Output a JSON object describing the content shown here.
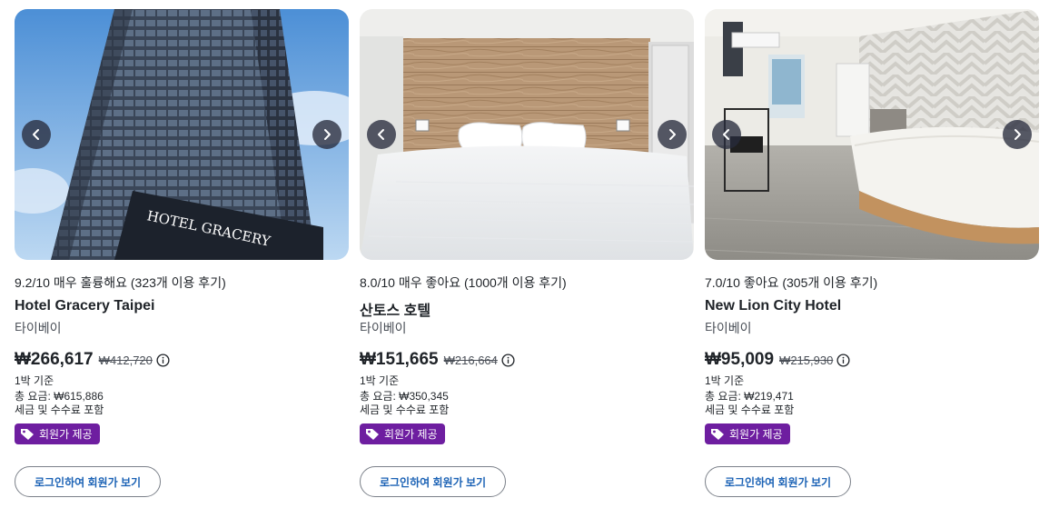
{
  "colors": {
    "member_badge_bg": "#6e1ea0",
    "login_button_text": "#1b62b5",
    "arrow_bg": "#2c3040"
  },
  "icons": {
    "prev": "chevron-left-icon",
    "next": "chevron-right-icon",
    "info": "info-circle-icon",
    "tag": "tag-icon"
  },
  "hotels": [
    {
      "rating": "9.2/10 매우 훌륭해요 (323개 이용 후기)",
      "name": "Hotel Gracery Taipei",
      "city": "타이베이",
      "price": "₩266,617",
      "old_price": "₩412,720",
      "per_night": "1박 기준",
      "total": "총 요금: ₩615,886",
      "taxes": "세금 및 수수료 포함",
      "badge": "회원가 제공",
      "login_button": "로그인하여 회원가 보기",
      "image_sign": "HOTEL GRACERY"
    },
    {
      "rating": "8.0/10 매우 좋아요 (1000개 이용 후기)",
      "name": "산토스 호텔",
      "city": "타이베이",
      "price": "₩151,665",
      "old_price": "₩216,664",
      "per_night": "1박 기준",
      "total": "총 요금: ₩350,345",
      "taxes": "세금 및 수수료 포함",
      "badge": "회원가 제공",
      "login_button": "로그인하여 회원가 보기"
    },
    {
      "rating": "7.0/10 좋아요 (305개 이용 후기)",
      "name": "New Lion City Hotel",
      "city": "타이베이",
      "price": "₩95,009",
      "old_price": "₩215,930",
      "per_night": "1박 기준",
      "total": "총 요금: ₩219,471",
      "taxes": "세금 및 수수료 포함",
      "badge": "회원가 제공",
      "login_button": "로그인하여 회원가 보기"
    }
  ]
}
